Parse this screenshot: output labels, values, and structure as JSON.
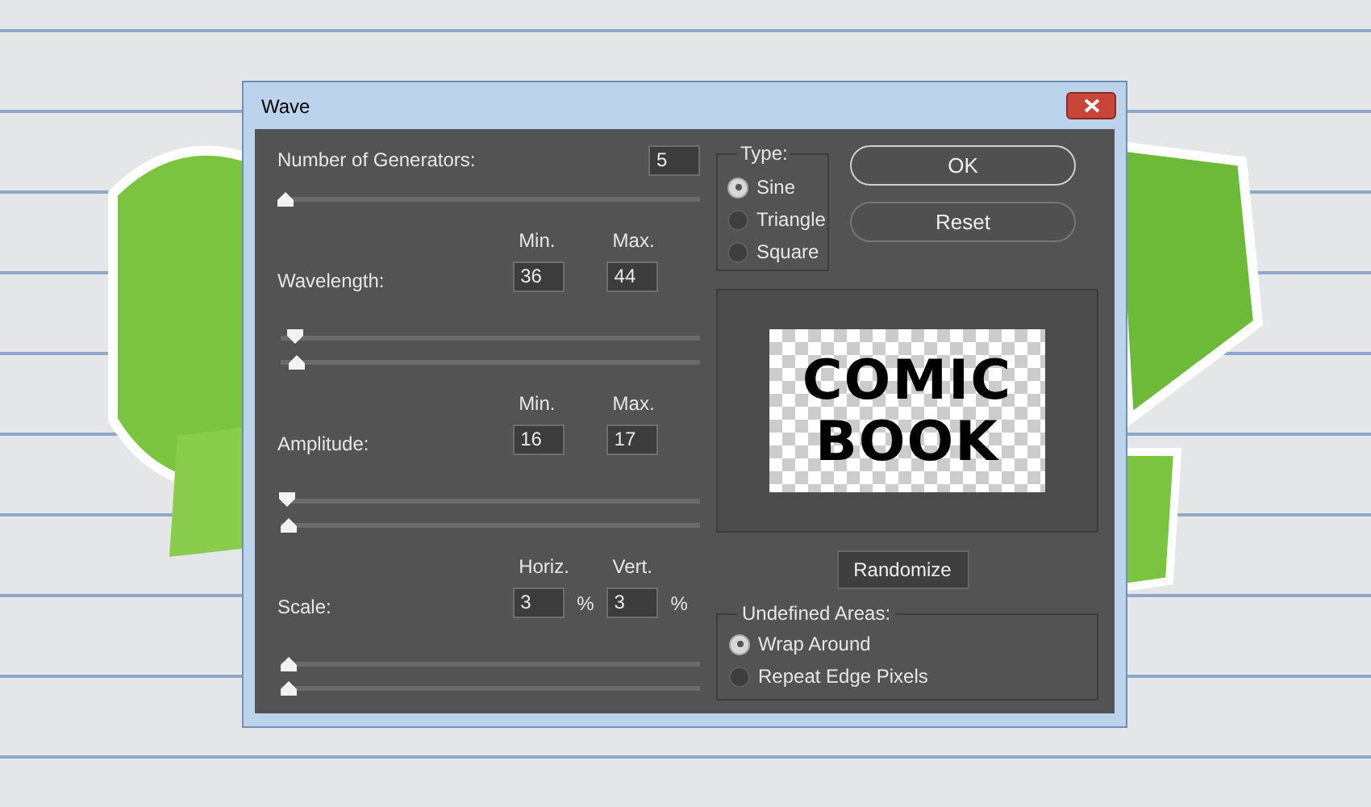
{
  "window": {
    "title": "Wave"
  },
  "generators": {
    "label": "Number of Generators:",
    "value": "5",
    "level": 0.01
  },
  "params": [
    {
      "label": "Wavelength:",
      "headers": [
        "Min.",
        "Max."
      ],
      "fields": [
        {
          "value": "36"
        },
        {
          "value": "44"
        }
      ],
      "sliders": [
        {
          "kind": "down",
          "level": 0.035
        },
        {
          "kind": "up",
          "level": 0.04
        }
      ]
    },
    {
      "label": "Amplitude:",
      "headers": [
        "Min.",
        "Max."
      ],
      "fields": [
        {
          "value": "16"
        },
        {
          "value": "17"
        }
      ],
      "sliders": [
        {
          "kind": "down",
          "level": 0.015
        },
        {
          "kind": "up",
          "level": 0.02
        }
      ]
    },
    {
      "label": "Scale:",
      "headers": [
        "Horiz.",
        "Vert."
      ],
      "fields": [
        {
          "value": "3",
          "unit": "%"
        },
        {
          "value": "3",
          "unit": "%"
        }
      ],
      "sliders": [
        {
          "kind": "up",
          "level": 0.02
        },
        {
          "kind": "up",
          "level": 0.02
        }
      ]
    }
  ],
  "type_group": {
    "title": "Type:",
    "options": [
      {
        "label": "Sine",
        "selected": true
      },
      {
        "label": "Triangle",
        "selected": false
      },
      {
        "label": "Square",
        "selected": false
      }
    ]
  },
  "buttons": [
    {
      "label": "OK",
      "default": true
    },
    {
      "label": "Reset",
      "default": false
    }
  ],
  "preview": {
    "lines": [
      "COMIC",
      "BOOK"
    ]
  },
  "randomize": "Randomize",
  "undefined_areas": {
    "title": "Undefined Areas:",
    "options": [
      {
        "label": "Wrap Around",
        "selected": true
      },
      {
        "label": "Repeat Edge Pixels",
        "selected": false
      }
    ]
  }
}
